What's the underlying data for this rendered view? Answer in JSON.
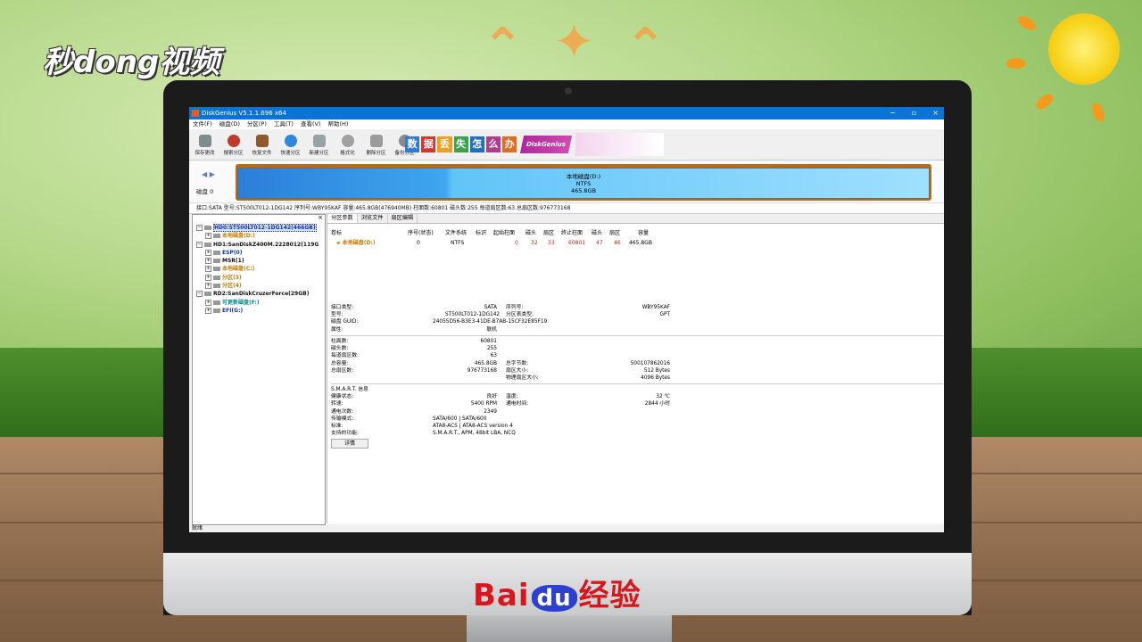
{
  "overlay": {
    "top_left_logo": "秒dong视频",
    "bottom_logo_bai": "Bai",
    "bottom_logo_du": "du",
    "bottom_logo_suffix": "经验"
  },
  "window": {
    "title": "DiskGenius V5.1.1.696 x64",
    "controls": [
      "−",
      "▫",
      "×"
    ]
  },
  "menu": [
    "文件(F)",
    "磁盘(D)",
    "分区(P)",
    "工具(T)",
    "查看(V)",
    "帮助(H)"
  ],
  "toolbar": {
    "items": [
      {
        "label": "保存更改",
        "icon": "save-icon",
        "color": "#7f8c8d"
      },
      {
        "label": "搜索分区",
        "icon": "search-icon",
        "color": "#c0392b"
      },
      {
        "label": "恢复文件",
        "icon": "recover-icon",
        "color": "#8e5a2b"
      },
      {
        "label": "快速分区",
        "icon": "quick-partition-icon",
        "color": "#2e86de"
      },
      {
        "label": "新建分区",
        "icon": "new-partition-icon",
        "color": "#95a5a6"
      },
      {
        "label": "格式化",
        "icon": "format-icon",
        "color": "#a0a0a0"
      },
      {
        "label": "删除分区",
        "icon": "delete-icon",
        "color": "#9b9b9b"
      },
      {
        "label": "备份分区",
        "icon": "backup-icon",
        "color": "#8a8a8a"
      }
    ],
    "ad_tiles": [
      {
        "text": "数",
        "color": "#2e7bd6"
      },
      {
        "text": "据",
        "color": "#d9342b"
      },
      {
        "text": "丢",
        "color": "#f0a020"
      },
      {
        "text": "失",
        "color": "#3aa24a"
      },
      {
        "text": "怎",
        "color": "#1c6fc2"
      },
      {
        "text": "么",
        "color": "#b33a8c"
      },
      {
        "text": "办",
        "color": "#e36b1f"
      }
    ],
    "ad_banner": "DiskGenius"
  },
  "diskmap": {
    "nav_arrows": "◀ ▶",
    "disk_label": "磁盘 0",
    "partition_name": "本地磁盘(D:)",
    "partition_fs": "NTFS",
    "partition_size": "465.8GB"
  },
  "infobar": "接口:SATA  型号:ST500LT012-1DG142  序列号:WBY95KAF  容量:465.8GB(476940MB)  柱面数:60801  磁头数:255  每道扇区数:63  总扇区数:976773168",
  "tree": {
    "close": "×",
    "items": [
      {
        "text": "HD0:ST500LT012-1DG142(466GB)",
        "style": "t-sel",
        "indent": 0
      },
      {
        "text": "本地磁盘(D:)",
        "style": "t-orange",
        "indent": 1
      },
      {
        "text": "HD1:SanDiskZ400M.2228012(119G",
        "style": "t-dark",
        "indent": 0
      },
      {
        "text": "ESP(0)",
        "style": "t-blue",
        "indent": 1
      },
      {
        "text": "MSR(1)",
        "style": "t-dark",
        "indent": 1
      },
      {
        "text": "本地磁盘(C:)",
        "style": "t-orange",
        "indent": 1
      },
      {
        "text": "分区(3)",
        "style": "t-orange",
        "indent": 1
      },
      {
        "text": "分区(4)",
        "style": "t-orange",
        "indent": 1
      },
      {
        "text": "RD2:SanDiskCruzerForce(29GB)",
        "style": "t-dark",
        "indent": 0
      },
      {
        "text": "可更新磁盘(F:)",
        "style": "t-cyan",
        "indent": 1
      },
      {
        "text": "EFI(G:)",
        "style": "t-blue",
        "indent": 1
      }
    ]
  },
  "tabs": [
    "分区参数",
    "浏览文件",
    "扇区编辑"
  ],
  "partition_table": {
    "headers": [
      "卷标",
      "序号(状态)",
      "文件系统",
      "标识",
      "起始柱面",
      "磁头",
      "扇区",
      "终止柱面",
      "磁头",
      "扇区",
      "容量"
    ],
    "rows": [
      [
        "本地磁盘(D:)",
        "0",
        "NTFS",
        "",
        "0",
        "32",
        "33",
        "60801",
        "47",
        "46",
        "465.8GB"
      ]
    ]
  },
  "details": {
    "block1_left": [
      [
        "接口类型:",
        "SATA"
      ],
      [
        "型号:",
        "ST500LT012-1DG142"
      ],
      [
        "磁盘 GUID:",
        "24055D56-B3E3-41DE-B7AB-15CF32E85F19"
      ],
      [
        "属性:",
        "联机"
      ]
    ],
    "block1_right": [
      [
        "序列号:",
        "WBY95KAF"
      ],
      [
        "分区表类型:",
        "GPT"
      ]
    ],
    "block2_left": [
      [
        "柱面数:",
        "60801"
      ],
      [
        "磁头数:",
        "255"
      ],
      [
        "每道扇区数:",
        "63"
      ],
      [
        "总容量:",
        "465.8GB"
      ],
      [
        "总扇区数:",
        "976773168"
      ]
    ],
    "block2_right": [
      [
        "总字节数:",
        "500107862016"
      ],
      [
        "扇区大小:",
        "512 Bytes"
      ],
      [
        "物理扇区大小:",
        "4096 Bytes"
      ]
    ],
    "smart_title": "S.M.A.R.T. 信息",
    "block3_left": [
      [
        "健康状态:",
        "良好"
      ],
      [
        "转速:",
        "5400 RPM"
      ],
      [
        "通电次数:",
        "2349"
      ],
      [
        "传输模式:",
        "SATA/600 | SATA/600"
      ],
      [
        "标准:",
        "ATA8-ACS | ATA8-ACS version 4"
      ],
      [
        "支持的功能:",
        "S.M.A.R.T., APM, 48bit LBA, NCQ"
      ]
    ],
    "block3_right": [
      [
        "温度:",
        "32 ℃"
      ],
      [
        "通电时间:",
        "2844 小时"
      ]
    ],
    "detail_button": "详情"
  },
  "status": "就绪"
}
